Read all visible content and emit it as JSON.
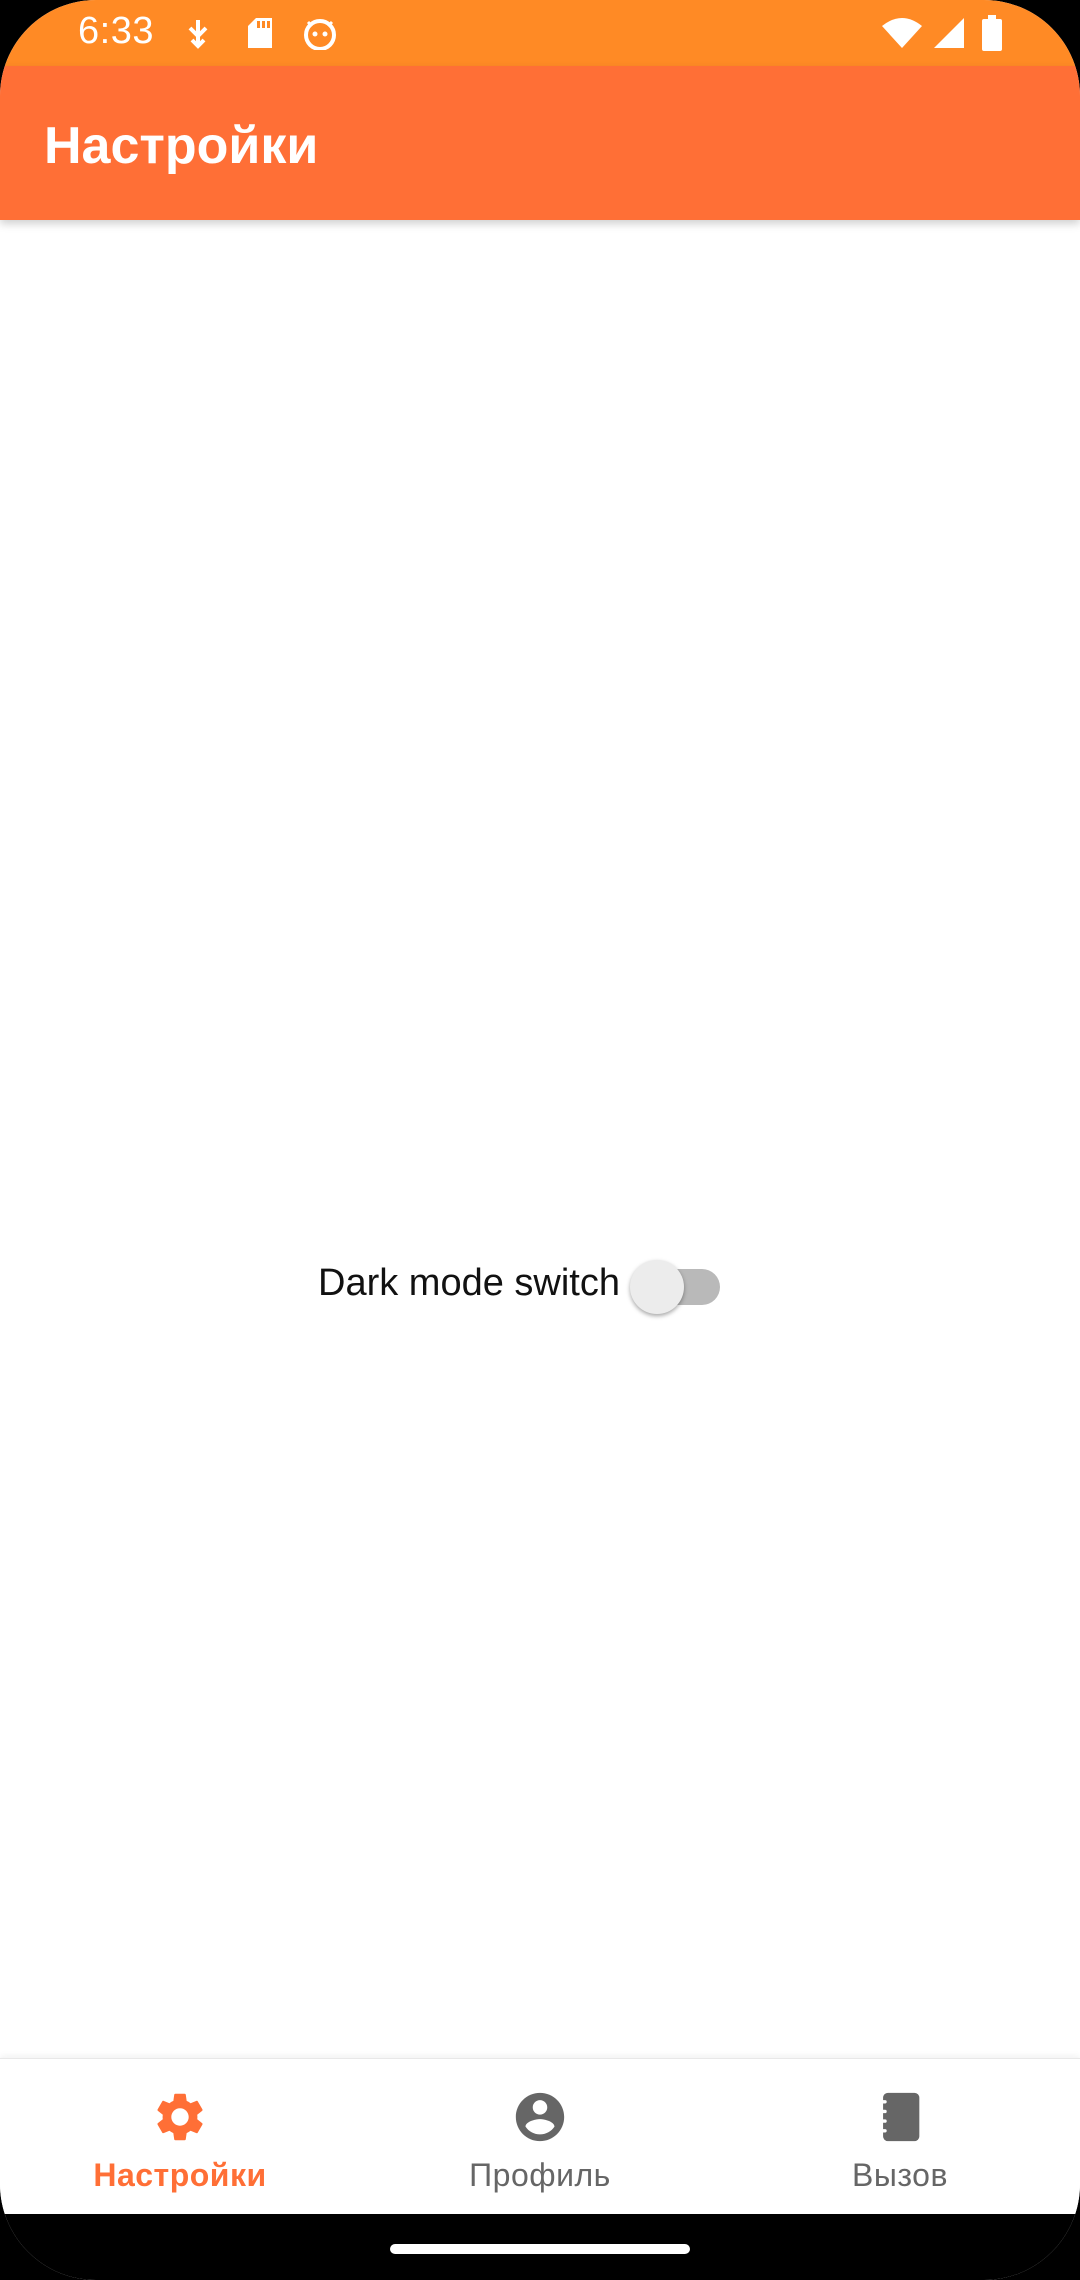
{
  "status_bar": {
    "time": "6:33",
    "icons": [
      "usb-debug-icon",
      "sd-card-icon",
      "android-icon",
      "wifi-icon",
      "signal-icon",
      "battery-icon"
    ]
  },
  "app_bar": {
    "title": "Настройки"
  },
  "settings": {
    "dark_mode_label": "Dark mode switch",
    "dark_mode_enabled": false
  },
  "bottom_nav": {
    "items": [
      {
        "label": "Настройки",
        "icon": "gear-icon",
        "active": true
      },
      {
        "label": "Профиль",
        "icon": "account-circle-icon",
        "active": false
      },
      {
        "label": "Вызов",
        "icon": "contacts-book-icon",
        "active": false
      }
    ]
  },
  "colors": {
    "status_bar": "#ff8a25",
    "app_bar": "#ff6f36",
    "accent": "#ff6f36",
    "inactive": "#666666"
  }
}
